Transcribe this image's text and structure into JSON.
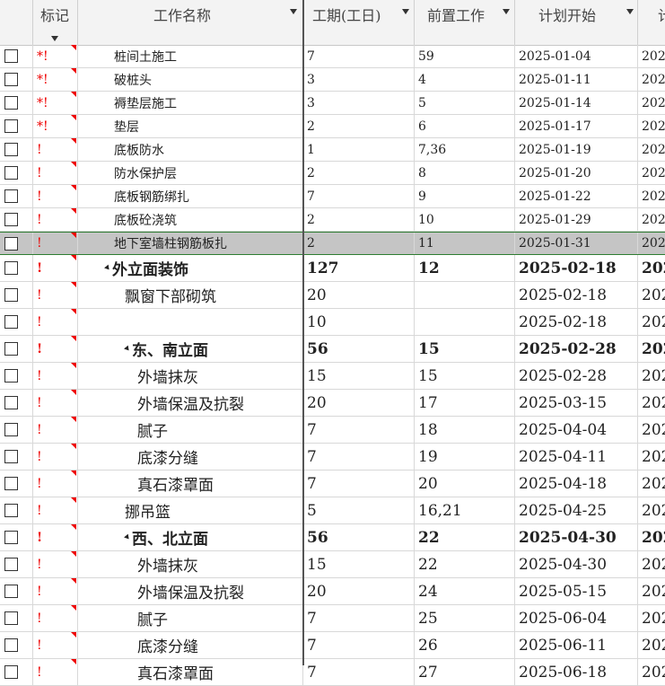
{
  "header": {
    "col_mark": "标记",
    "col_name": "工作名称",
    "col_duration": "工期(工日)",
    "col_pred": "前置工作",
    "col_start": "计划开始",
    "col_next": "计"
  },
  "rows": [
    {
      "mark": "*!",
      "name": "桩间土施工",
      "indent": 0,
      "dur": "7",
      "pred": "59",
      "start": "2025-01-04",
      "next": "202",
      "bold": false,
      "small": true,
      "selected": false
    },
    {
      "mark": "*!",
      "name": "破桩头",
      "indent": 0,
      "dur": "3",
      "pred": "4",
      "start": "2025-01-11",
      "next": "202",
      "bold": false,
      "small": true,
      "selected": false
    },
    {
      "mark": "*!",
      "name": "褥垫层施工",
      "indent": 0,
      "dur": "3",
      "pred": "5",
      "start": "2025-01-14",
      "next": "202",
      "bold": false,
      "small": true,
      "selected": false
    },
    {
      "mark": "*!",
      "name": "垫层",
      "indent": 0,
      "dur": "2",
      "pred": "6",
      "start": "2025-01-17",
      "next": "202",
      "bold": false,
      "small": true,
      "selected": false
    },
    {
      "mark": "!",
      "name": "底板防水",
      "indent": 0,
      "dur": "1",
      "pred": "7,36",
      "start": "2025-01-19",
      "next": "202",
      "bold": false,
      "small": true,
      "selected": false
    },
    {
      "mark": "!",
      "name": "防水保护层",
      "indent": 0,
      "dur": "2",
      "pred": "8",
      "start": "2025-01-20",
      "next": "202",
      "bold": false,
      "small": true,
      "selected": false
    },
    {
      "mark": "!",
      "name": "底板钢筋绑扎",
      "indent": 0,
      "dur": "7",
      "pred": "9",
      "start": "2025-01-22",
      "next": "202",
      "bold": false,
      "small": true,
      "selected": false
    },
    {
      "mark": "!",
      "name": "底板砼浇筑",
      "indent": 0,
      "dur": "2",
      "pred": "10",
      "start": "2025-01-29",
      "next": "202",
      "bold": false,
      "small": true,
      "selected": false
    },
    {
      "mark": "!",
      "name": "地下室墙柱钢筋板扎",
      "indent": 0,
      "dur": "2",
      "pred": "11",
      "start": "2025-01-31",
      "next": "202",
      "bold": false,
      "small": true,
      "selected": true
    },
    {
      "mark": "!",
      "name": "外立面装饰",
      "indent": 1,
      "dur": "127",
      "pred": "12",
      "start": "2025-02-18",
      "next": "202",
      "bold": true,
      "small": false,
      "selected": false,
      "group": true
    },
    {
      "mark": "!",
      "name": "飘窗下部砌筑",
      "indent": 2,
      "dur": "20",
      "pred": "",
      "start": "2025-02-18",
      "next": "202",
      "bold": false,
      "small": false,
      "selected": false
    },
    {
      "mark": "!",
      "name": "",
      "indent": 2,
      "dur": "10",
      "pred": "",
      "start": "2025-02-18",
      "next": "202",
      "bold": false,
      "small": false,
      "selected": false
    },
    {
      "mark": "!",
      "name": "东、南立面",
      "indent": 2,
      "dur": "56",
      "pred": "15",
      "start": "2025-02-28",
      "next": "202",
      "bold": true,
      "small": false,
      "selected": false,
      "group": true
    },
    {
      "mark": "!",
      "name": "外墙抹灰",
      "indent": 3,
      "dur": "15",
      "pred": "15",
      "start": "2025-02-28",
      "next": "202",
      "bold": false,
      "small": false,
      "selected": false
    },
    {
      "mark": "!",
      "name": "外墙保温及抗裂",
      "indent": 3,
      "dur": "20",
      "pred": "17",
      "start": "2025-03-15",
      "next": "202",
      "bold": false,
      "small": false,
      "selected": false
    },
    {
      "mark": "!",
      "name": "腻子",
      "indent": 3,
      "dur": "7",
      "pred": "18",
      "start": "2025-04-04",
      "next": "202",
      "bold": false,
      "small": false,
      "selected": false
    },
    {
      "mark": "!",
      "name": "底漆分缝",
      "indent": 3,
      "dur": "7",
      "pred": "19",
      "start": "2025-04-11",
      "next": "202",
      "bold": false,
      "small": false,
      "selected": false
    },
    {
      "mark": "!",
      "name": "真石漆罩面",
      "indent": 3,
      "dur": "7",
      "pred": "20",
      "start": "2025-04-18",
      "next": "202",
      "bold": false,
      "small": false,
      "selected": false
    },
    {
      "mark": "!",
      "name": "挪吊篮",
      "indent": 2,
      "dur": "5",
      "pred": "16,21",
      "start": "2025-04-25",
      "next": "202",
      "bold": false,
      "small": false,
      "selected": false
    },
    {
      "mark": "!",
      "name": "西、北立面",
      "indent": 2,
      "dur": "56",
      "pred": "22",
      "start": "2025-04-30",
      "next": "202",
      "bold": true,
      "small": false,
      "selected": false,
      "group": true
    },
    {
      "mark": "!",
      "name": "外墙抹灰",
      "indent": 3,
      "dur": "15",
      "pred": "22",
      "start": "2025-04-30",
      "next": "202",
      "bold": false,
      "small": false,
      "selected": false
    },
    {
      "mark": "!",
      "name": "外墙保温及抗裂",
      "indent": 3,
      "dur": "20",
      "pred": "24",
      "start": "2025-05-15",
      "next": "202",
      "bold": false,
      "small": false,
      "selected": false
    },
    {
      "mark": "!",
      "name": "腻子",
      "indent": 3,
      "dur": "7",
      "pred": "25",
      "start": "2025-06-04",
      "next": "202",
      "bold": false,
      "small": false,
      "selected": false
    },
    {
      "mark": "!",
      "name": "底漆分缝",
      "indent": 3,
      "dur": "7",
      "pred": "26",
      "start": "2025-06-11",
      "next": "202",
      "bold": false,
      "small": false,
      "selected": false
    },
    {
      "mark": "!",
      "name": "真石漆罩面",
      "indent": 3,
      "dur": "7",
      "pred": "27",
      "start": "2025-06-18",
      "next": "202",
      "bold": false,
      "small": false,
      "selected": false
    }
  ],
  "colors": {
    "mark": "#e00000",
    "selected_bg": "#c5c5c5",
    "selected_border": "#2e7d32"
  }
}
